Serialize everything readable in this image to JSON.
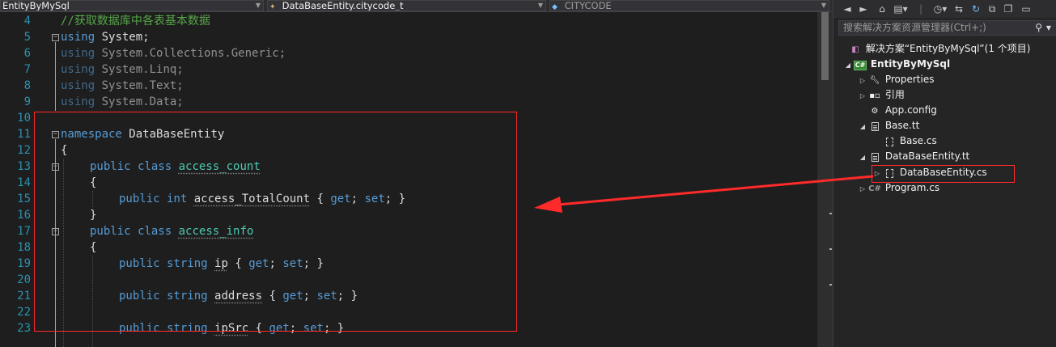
{
  "navbar": {
    "project": "EntityByMySql",
    "type": "DataBaseEntity.citycode_t",
    "member": "CITYCODE"
  },
  "editor": {
    "line_numbers": [
      "4",
      "5",
      "6",
      "7",
      "8",
      "9",
      "10",
      "11",
      "12",
      "13",
      "14",
      "15",
      "16",
      "17",
      "18",
      "19",
      "20",
      "21",
      "22",
      "23"
    ],
    "lines": {
      "l4_comment": "//获取数据库中各表基本数据",
      "using_kw": "using",
      "l5_ns": "System;",
      "l6_ns": "System.Collections.Generic;",
      "l7_ns": "System.Linq;",
      "l8_ns": "System.Text;",
      "l9_ns": "System.Data;",
      "namespace_kw": "namespace",
      "namespace_name": "DataBaseEntity",
      "open_brace": "{",
      "close_brace": "}",
      "public_kw": "public",
      "class_kw": "class",
      "int_kw": "int",
      "string_kw": "string",
      "get_kw": "get",
      "set_kw": "set",
      "class1_name": "access_count",
      "class1_prop": "access_TotalCount",
      "class2_name": "access_info",
      "prop_ip": "ip",
      "prop_address": "address",
      "prop_ipsrc": "ipSrc",
      "accessor_open": " { ",
      "semi_space": "; ",
      "semi_close": "; }"
    }
  },
  "solution_explorer": {
    "search_placeholder": "搜索解决方案资源管理器(Ctrl+;)",
    "search_icon": "magnifier-icon",
    "items": [
      {
        "label": "解决方案“EntityByMySql”(1 个项目)",
        "icon": "solution-icon"
      },
      {
        "label": "EntityByMySql",
        "icon": "csharp-project-icon"
      },
      {
        "label": "Properties",
        "icon": "wrench-icon"
      },
      {
        "label": "引用",
        "icon": "references-icon"
      },
      {
        "label": "App.config",
        "icon": "config-file-icon"
      },
      {
        "label": "Base.tt",
        "icon": "template-file-icon"
      },
      {
        "label": "Base.cs",
        "icon": "generated-file-icon"
      },
      {
        "label": "DataBaseEntity.tt",
        "icon": "template-file-icon"
      },
      {
        "label": "DataBaseEntity.cs",
        "icon": "generated-file-icon"
      },
      {
        "label": "Program.cs",
        "icon": "csharp-file-icon"
      }
    ]
  },
  "colors": {
    "annotation_red": "#ff2a2a",
    "keyword": "#569cd6",
    "comment": "#57a64a",
    "line_number": "#2b91af"
  }
}
